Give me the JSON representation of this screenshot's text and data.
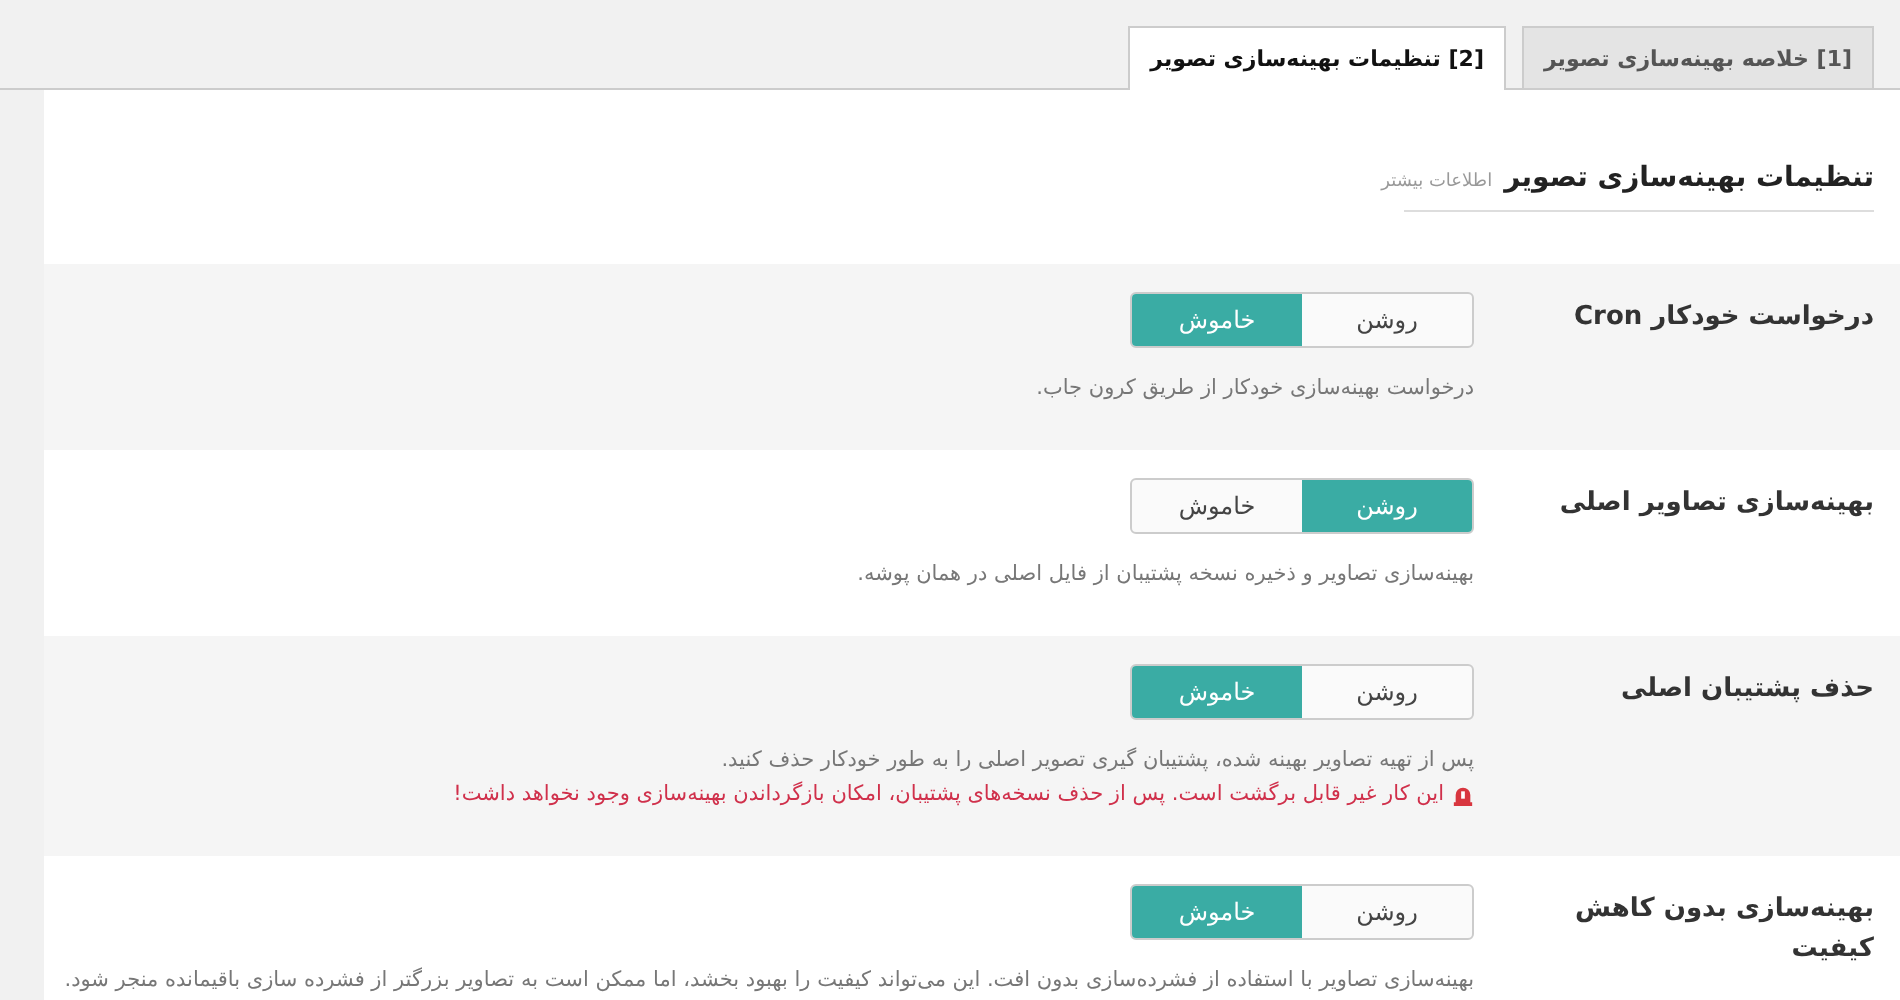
{
  "tabs": [
    {
      "label": "[1] خلاصه بهینه‌سازی تصویر",
      "selected": false
    },
    {
      "label": "[2] تنظیمات بهینه‌سازی تصویر",
      "selected": true
    }
  ],
  "section": {
    "title": "تنظیمات بهینه‌سازی تصویر",
    "link": "اطلاعات بیشتر"
  },
  "settings": [
    {
      "label": "درخواست خودکار Cron",
      "on": false,
      "on_label": "روشن",
      "off_label": "خاموش",
      "description": "درخواست بهینه‌سازی خودکار از طریق کرون جاب."
    },
    {
      "label": "بهینه‌سازی تصاویر اصلی",
      "on": true,
      "on_label": "روشن",
      "off_label": "خاموش",
      "description": "بهینه‌سازی تصاویر و ذخیره نسخه پشتیبان از فایل اصلی در همان پوشه."
    },
    {
      "label": "حذف پشتیبان اصلی",
      "on": false,
      "on_label": "روشن",
      "off_label": "خاموش",
      "description": "پس از تهیه تصاویر بهینه شده، پشتیبان گیری تصویر اصلی را به طور خودکار حذف کنید.",
      "warning": "این کار غیر قابل برگشت است. پس از حذف نسخه‌های پشتیبان، امکان بازگرداندن بهینه‌سازی وجود نخواهد داشت!"
    },
    {
      "label": "بهینه‌سازی بدون کاهش کیفیت",
      "on": false,
      "on_label": "روشن",
      "off_label": "خاموش",
      "description": "بهینه‌سازی تصاویر با استفاده از فشرده‌سازی بدون افت. این می‌تواند کیفیت را بهبود بخشد، اما ممکن است به تصاویر بزرگتر از فشرده سازی باقیمانده منجر شود."
    }
  ]
}
